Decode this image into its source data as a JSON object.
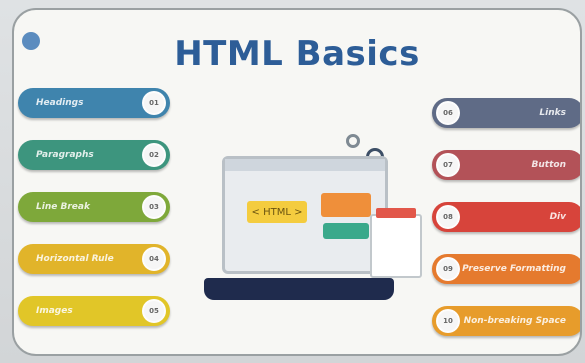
{
  "title": "HTML Basics",
  "illustration": {
    "tag_text": "< HTML >"
  },
  "left_items": [
    {
      "label": "Headings",
      "num": "01",
      "color": "#3f84ad"
    },
    {
      "label": "Paragraphs",
      "num": "02",
      "color": "#3d957e"
    },
    {
      "label": "Line Break",
      "num": "03",
      "color": "#7ea83a"
    },
    {
      "label": "Horizontal Rule",
      "num": "04",
      "color": "#e1b42a"
    },
    {
      "label": "Images",
      "num": "05",
      "color": "#e1c628"
    }
  ],
  "right_items": [
    {
      "label": "Links",
      "num": "06",
      "color": "#5f6b86"
    },
    {
      "label": "Button",
      "num": "07",
      "color": "#b35258"
    },
    {
      "label": "Div",
      "num": "08",
      "color": "#d7443b"
    },
    {
      "label": "Preserve Formatting",
      "num": "09",
      "color": "#e57a2e"
    },
    {
      "label": "Non-breaking Space",
      "num": "10",
      "color": "#e79c2b"
    }
  ]
}
